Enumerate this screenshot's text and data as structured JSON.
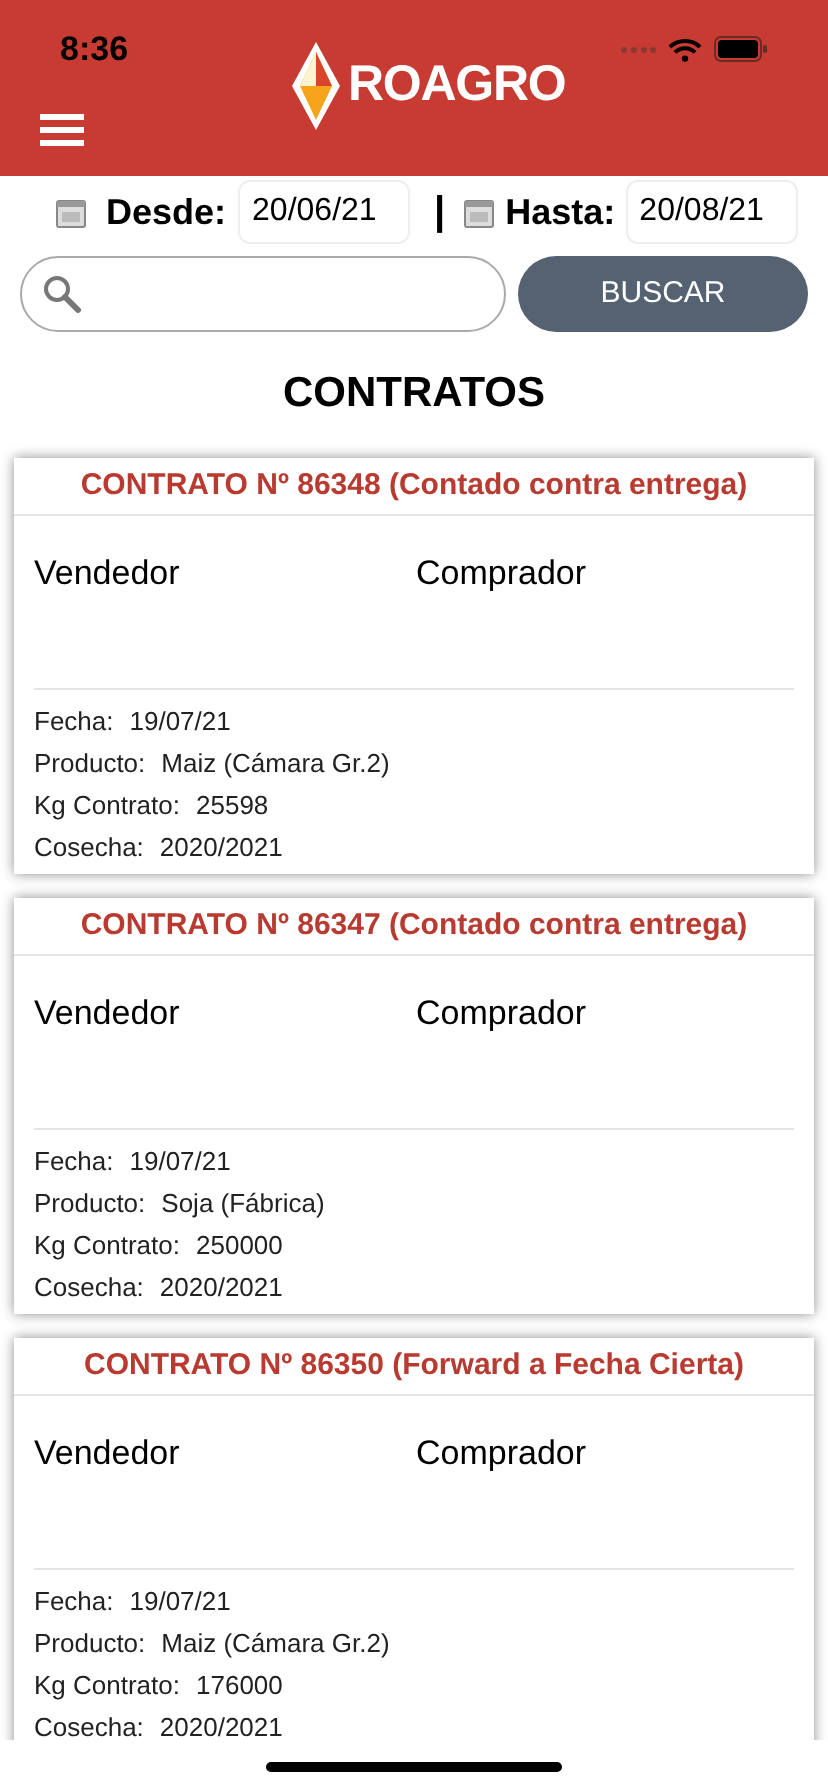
{
  "status_bar": {
    "time": "8:36"
  },
  "header": {
    "logo_text": "ROAGRO"
  },
  "filters": {
    "from_label": "Desde:",
    "from_value": "20/06/21",
    "separator": "|",
    "to_label": "Hasta:",
    "to_value": "20/08/21"
  },
  "search": {
    "button": "BUSCAR"
  },
  "title": "CONTRATOS",
  "contracts": [
    {
      "title": "CONTRATO Nº 86348 (Contado contra entrega)",
      "seller_label": "Vendedor",
      "buyer_label": "Comprador",
      "details": [
        {
          "label": "Fecha:",
          "value": "19/07/21"
        },
        {
          "label": "Producto:",
          "value": "Maiz (Cámara Gr.2)"
        },
        {
          "label": "Kg Contrato:",
          "value": "25598"
        },
        {
          "label": "Cosecha:",
          "value": "2020/2021"
        }
      ]
    },
    {
      "title": "CONTRATO Nº 86347 (Contado contra entrega)",
      "seller_label": "Vendedor",
      "buyer_label": "Comprador",
      "details": [
        {
          "label": "Fecha:",
          "value": "19/07/21"
        },
        {
          "label": "Producto:",
          "value": "Soja (Fábrica)"
        },
        {
          "label": "Kg Contrato:",
          "value": "250000"
        },
        {
          "label": "Cosecha:",
          "value": "2020/2021"
        }
      ]
    },
    {
      "title": "CONTRATO Nº 86350 (Forward a Fecha Cierta)",
      "seller_label": "Vendedor",
      "buyer_label": "Comprador",
      "details": [
        {
          "label": "Fecha:",
          "value": "19/07/21"
        },
        {
          "label": "Producto:",
          "value": "Maiz (Cámara Gr.2)"
        },
        {
          "label": "Kg Contrato:",
          "value": "176000"
        },
        {
          "label": "Cosecha:",
          "value": "2020/2021"
        }
      ]
    }
  ]
}
